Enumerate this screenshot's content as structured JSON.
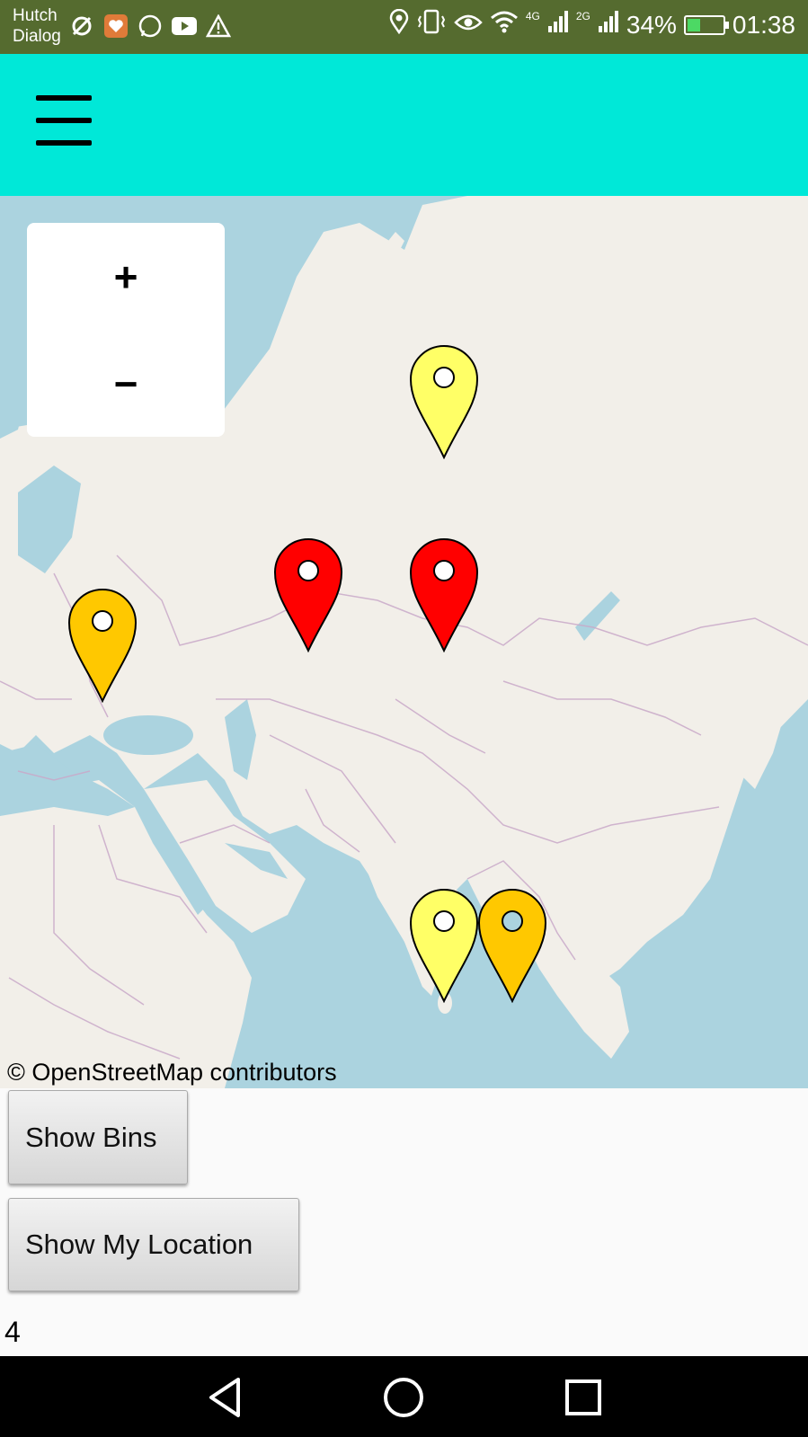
{
  "status_bar": {
    "carrier_line1": "Hutch",
    "carrier_line2": "Dialog",
    "network_4g": "4G",
    "network_2g": "2G",
    "battery": "34%",
    "time": "01:38",
    "battery_level": 0.34
  },
  "app_bar": {
    "menu_icon": "hamburger-menu-icon"
  },
  "map": {
    "zoom_in_label": "+",
    "zoom_out_label": "−",
    "attribution": "© OpenStreetMap contributors",
    "markers": [
      {
        "name": "marker-yellow-1",
        "color": "#ffff66"
      },
      {
        "name": "marker-red-1",
        "color": "#ff0000"
      },
      {
        "name": "marker-red-2",
        "color": "#ff0000"
      },
      {
        "name": "marker-orange-1",
        "color": "#ffc800"
      },
      {
        "name": "marker-yellow-2",
        "color": "#ffff66"
      },
      {
        "name": "marker-orange-2",
        "color": "#ffc800"
      }
    ]
  },
  "buttons": {
    "show_bins": "Show Bins",
    "show_my_location": "Show My Location"
  },
  "result_text": "4",
  "colors": {
    "status_bar": "#556b2f",
    "app_bar": "#00e8d8",
    "sea": "#abd3df",
    "land": "#f2efe9"
  }
}
